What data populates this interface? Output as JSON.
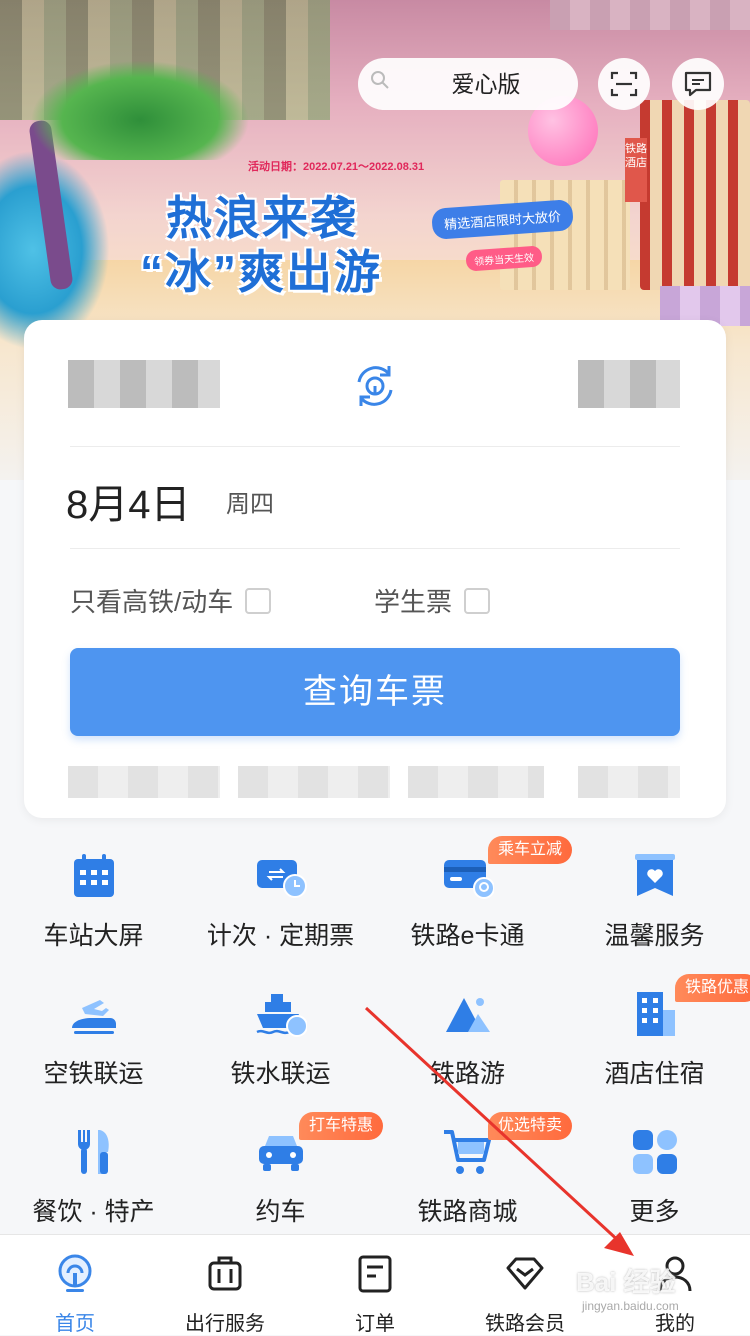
{
  "header": {
    "search_label": "爱心版",
    "scan_icon": "scan-icon",
    "message_icon": "message-icon"
  },
  "banner": {
    "date_text": "活动日期：2022.07.21～2022.08.31",
    "title_line1": "热浪来袭",
    "title_line2": "“冰”爽出游",
    "tag": "精选酒店限时大放价",
    "subtag": "领券当天生效",
    "building_sign": "铁路酒店"
  },
  "ticket": {
    "date": "8月4日",
    "weekday": "周四",
    "option_highspeed": "只看高铁/动车",
    "option_student": "学生票",
    "query_button": "查询车票"
  },
  "services": [
    {
      "label": "车站大屏",
      "icon": "calendar-screen-icon"
    },
    {
      "label": "计次 · 定期票",
      "icon": "ticket-clock-icon"
    },
    {
      "label": "铁路e卡通",
      "icon": "e-card-icon",
      "badge": "乘车立减"
    },
    {
      "label": "温馨服务",
      "icon": "heart-service-icon"
    },
    {
      "label": "空铁联运",
      "icon": "plane-train-icon"
    },
    {
      "label": "铁水联运",
      "icon": "ship-train-icon"
    },
    {
      "label": "铁路游",
      "icon": "mountain-icon"
    },
    {
      "label": "酒店住宿",
      "icon": "hotel-icon",
      "badge": "铁路优惠"
    },
    {
      "label": "餐饮 · 特产",
      "icon": "fork-knife-icon"
    },
    {
      "label": "约车",
      "icon": "car-icon",
      "badge": "打车特惠"
    },
    {
      "label": "铁路商城",
      "icon": "shopping-cart-icon",
      "badge": "优选特卖"
    },
    {
      "label": "更多",
      "icon": "more-grid-icon"
    }
  ],
  "tabs": [
    {
      "label": "首页",
      "icon": "home-rail-icon",
      "active": true
    },
    {
      "label": "出行服务",
      "icon": "luggage-icon"
    },
    {
      "label": "订单",
      "icon": "order-icon"
    },
    {
      "label": "铁路会员",
      "icon": "diamond-icon"
    },
    {
      "label": "我的",
      "icon": "user-icon"
    }
  ],
  "watermark": {
    "text": "Bai 经验",
    "sub": "jingyan.baidu.com"
  },
  "colors": {
    "primary": "#4e95f0",
    "icon_blue": "#2f7ee6",
    "badge_orange": "#ff7a4a",
    "arrow_red": "#e8342c"
  }
}
